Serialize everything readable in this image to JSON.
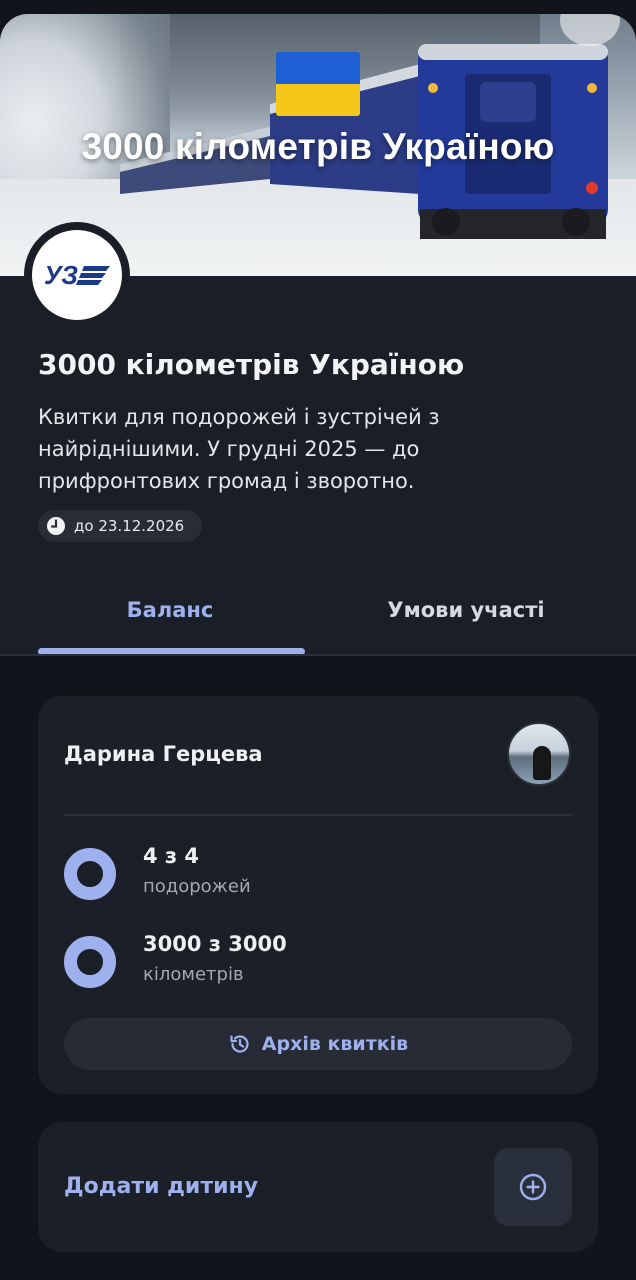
{
  "hero": {
    "title": "3000 кілометрів Україною",
    "flag_colors": [
      "#1f5fd6",
      "#f5c71a"
    ]
  },
  "organizer": {
    "logo_text": "УЗ",
    "logo_color": "#1d3a8a"
  },
  "campaign": {
    "title": "3000 кілометрів Україною",
    "description": "Квитки для подорожей і зустрічей з найріднішими. У грудні 2025 — до прифронтових громад і зворотно.",
    "deadline": "до 23.12.2026",
    "deadline_icon": "clock-icon"
  },
  "tabs": [
    {
      "label": "Баланс",
      "active": true
    },
    {
      "label": "Умови участі",
      "active": false
    }
  ],
  "balance": {
    "user_name": "Дарина Герцева",
    "stats": [
      {
        "value": "4 з 4",
        "label": "подорожей",
        "progress": 1.0
      },
      {
        "value": "3000 з 3000",
        "label": "кілометрів",
        "progress": 1.0
      }
    ],
    "archive_button": "Архів квитків",
    "archive_icon": "history-icon"
  },
  "add_child": {
    "label": "Додати дитину",
    "icon": "plus-circle-icon"
  },
  "colors": {
    "accent": "#9fb0ee",
    "background": "#11141b",
    "card": "#1b1f27"
  }
}
